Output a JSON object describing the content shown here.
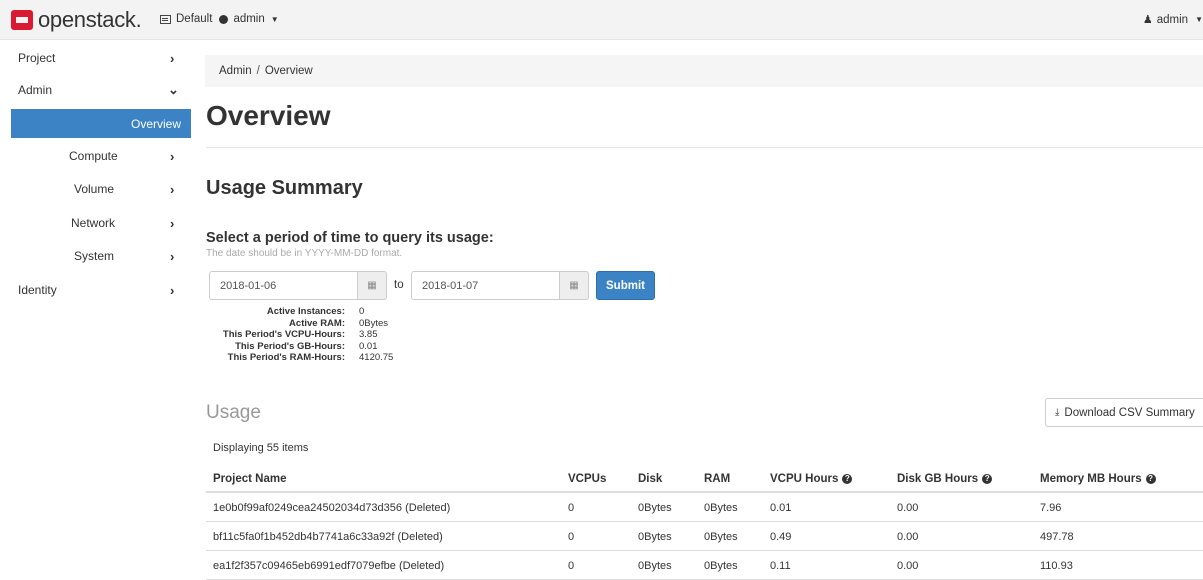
{
  "navbar": {
    "logo": "openstack.",
    "domain": "Default",
    "project": "admin",
    "user": "admin"
  },
  "sidebar": {
    "items": [
      {
        "label": "Project",
        "chevron": "›"
      },
      {
        "label": "Admin",
        "chevron": "⌄"
      },
      {
        "label": "Overview"
      },
      {
        "label": "Compute",
        "chevron": "›"
      },
      {
        "label": "Volume",
        "chevron": "›"
      },
      {
        "label": "Network",
        "chevron": "›"
      },
      {
        "label": "System",
        "chevron": "›"
      },
      {
        "label": "Identity",
        "chevron": "›"
      }
    ]
  },
  "breadcrumb": {
    "parent": "Admin",
    "sep": "/",
    "current": "Overview"
  },
  "page_title": "Overview",
  "usage_summary": {
    "title": "Usage Summary",
    "query_title": "Select a period of time to query its usage:",
    "help": "The date should be in YYYY-MM-DD format.",
    "start_date": "2018-01-06",
    "to_label": "to",
    "end_date": "2018-01-07",
    "submit_label": "Submit",
    "stats": [
      {
        "label": "Active Instances:",
        "value": "0"
      },
      {
        "label": "Active RAM:",
        "value": "0Bytes"
      },
      {
        "label": "This Period's VCPU-Hours:",
        "value": "3.85"
      },
      {
        "label": "This Period's GB-Hours:",
        "value": "0.01"
      },
      {
        "label": "This Period's RAM-Hours:",
        "value": "4120.75"
      }
    ]
  },
  "usage": {
    "title": "Usage",
    "download_label": "Download CSV Summary",
    "count": "Displaying 55 items",
    "columns": [
      "Project Name",
      "VCPUs",
      "Disk",
      "RAM",
      "VCPU Hours",
      "Disk GB Hours",
      "Memory MB Hours"
    ],
    "rows": [
      [
        "1e0b0f99af0249cea24502034d73d356 (Deleted)",
        "0",
        "0Bytes",
        "0Bytes",
        "0.01",
        "0.00",
        "7.96"
      ],
      [
        "bf11c5fa0f1b452db4b7741a6c33a92f (Deleted)",
        "0",
        "0Bytes",
        "0Bytes",
        "0.49",
        "0.00",
        "497.78"
      ],
      [
        "ea1f2f357c09465eb6991edf7079efbe (Deleted)",
        "0",
        "0Bytes",
        "0Bytes",
        "0.11",
        "0.00",
        "110.93"
      ]
    ]
  },
  "icons": {
    "project_switch": "list-icon",
    "calendar": "calendar-icon",
    "download": "download-icon",
    "help": "question-circle-icon",
    "user": "user-icon"
  },
  "colors": {
    "accent": "#3b83c5",
    "brand": "#da1a32"
  }
}
